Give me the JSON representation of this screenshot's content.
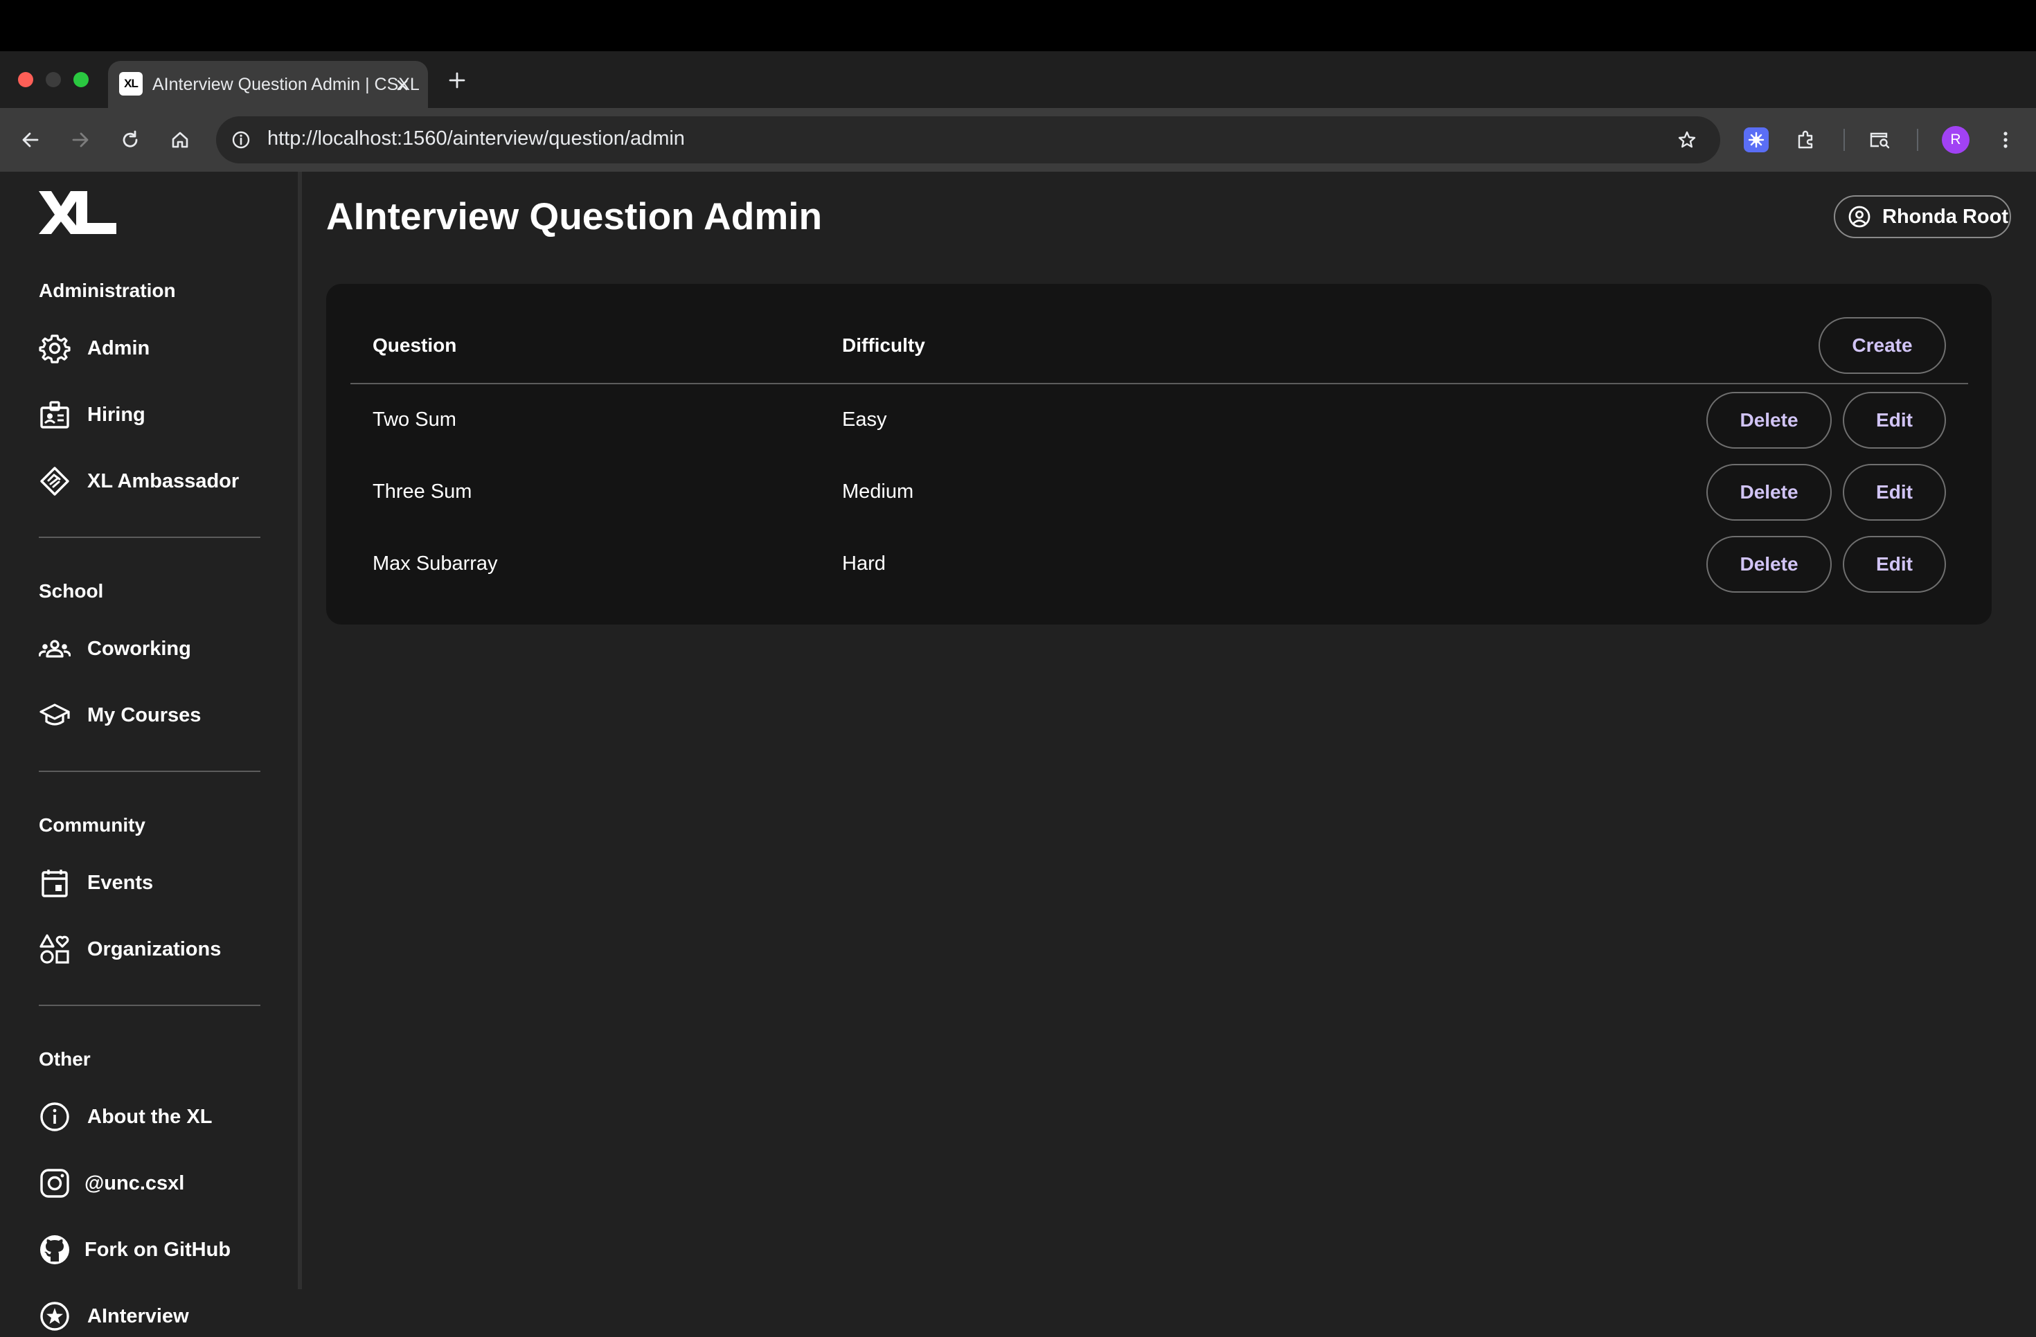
{
  "browser": {
    "tab_title": "AInterview Question Admin | CSXL",
    "url": "http://localhost:1560/ainterview/question/admin",
    "favicon_text": "XL",
    "profile_initial": "R",
    "profile_color": "#a142f4"
  },
  "sidebar": {
    "sections": [
      {
        "title": "Administration",
        "items": [
          {
            "label": "Admin",
            "icon": "gear-icon"
          },
          {
            "label": "Hiring",
            "icon": "badge-icon"
          },
          {
            "label": "XL Ambassador",
            "icon": "handshake-icon"
          }
        ]
      },
      {
        "title": "School",
        "items": [
          {
            "label": "Coworking",
            "icon": "groups-icon"
          },
          {
            "label": "My Courses",
            "icon": "school-icon"
          }
        ]
      },
      {
        "title": "Community",
        "items": [
          {
            "label": "Events",
            "icon": "calendar-icon"
          },
          {
            "label": "Organizations",
            "icon": "category-icon"
          }
        ]
      },
      {
        "title": "Other",
        "items": [
          {
            "label": "About the XL",
            "icon": "info-icon"
          },
          {
            "label": "@unc.csxl",
            "icon": "instagram-icon"
          },
          {
            "label": "Fork on GitHub",
            "icon": "github-icon"
          },
          {
            "label": "AInterview",
            "icon": "star-circle-icon"
          }
        ]
      }
    ]
  },
  "header": {
    "title": "AInterview Question Admin",
    "user_name": "Rhonda Root"
  },
  "table": {
    "columns": [
      "Question",
      "Difficulty"
    ],
    "create_label": "Create",
    "rows": [
      {
        "question": "Two Sum",
        "difficulty": "Easy"
      },
      {
        "question": "Three Sum",
        "difficulty": "Medium"
      },
      {
        "question": "Max Subarray",
        "difficulty": "Hard"
      }
    ],
    "delete_label": "Delete",
    "edit_label": "Edit"
  },
  "colors": {
    "background": "#212121",
    "card": "#141414",
    "button_text": "#d1c4f5"
  }
}
